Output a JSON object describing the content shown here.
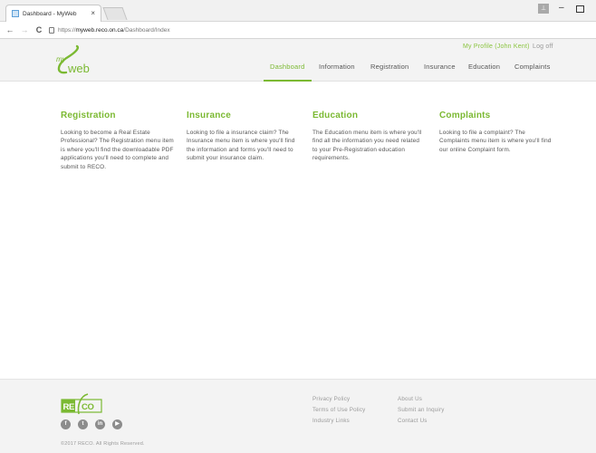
{
  "browser": {
    "tab_title": "Dashboard - MyWeb",
    "tab_close": "×",
    "user_icon_glyph": "⊥",
    "minimize_glyph": "–",
    "back_glyph": "←",
    "forward_glyph": "→",
    "reload_glyph": "C",
    "url_scheme": "https://",
    "url_host": "myweb.reco.on.ca",
    "url_path": "/Dashboard/Index"
  },
  "header": {
    "logo": {
      "small": "my",
      "large": "web"
    },
    "user_links": {
      "profile": "My Profile (John Kent)",
      "logout": "Log off"
    },
    "nav": [
      "Dashboard",
      "Information",
      "Registration",
      "Insurance",
      "Education",
      "Complaints"
    ],
    "active_nav": "Dashboard"
  },
  "sections": [
    {
      "title": "Registration",
      "body": "Looking to become a Real Estate Professional? The Registration menu item is where you'll find the downloadable PDF applications you'll need to complete and submit to RECO."
    },
    {
      "title": "Insurance",
      "body": "Looking to file a insurance claim? The Insurance menu item is where you'll find the information and forms you'll need to submit your insurance claim."
    },
    {
      "title": "Education",
      "body": "The Education menu item is where you'll find all the information you need related to your Pre-Registration education requirements."
    },
    {
      "title": "Complaints",
      "body": "Looking to file a complaint? The Complaints menu item is where you'll find our online Complaint form."
    }
  ],
  "footer": {
    "logo_text": "RECO",
    "social": [
      {
        "icon": "facebook-icon",
        "glyph": "f"
      },
      {
        "icon": "twitter-icon",
        "glyph": "t"
      },
      {
        "icon": "linkedin-icon",
        "glyph": "in"
      },
      {
        "icon": "youtube-icon",
        "glyph": "▶"
      }
    ],
    "copyright": "©2017 RECO. All Rights Reserved.",
    "links_col1": [
      "Privacy Policy",
      "Terms of Use Policy",
      "Industry Links"
    ],
    "links_col2": [
      "About Us",
      "Submit an Inquiry",
      "Contact Us"
    ]
  },
  "colors": {
    "brand_green": "#7bb932",
    "text_gray": "#555555",
    "footer_text": "#9a9a9a"
  }
}
